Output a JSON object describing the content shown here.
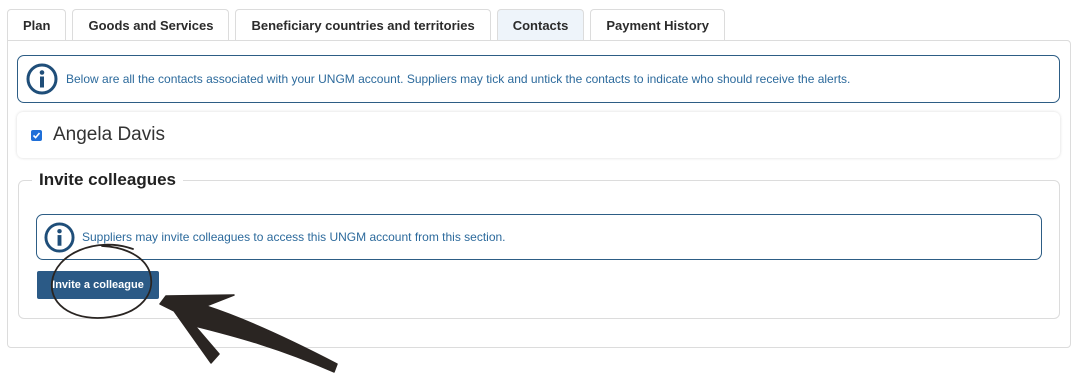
{
  "tabs": [
    {
      "label": "Plan",
      "active": false
    },
    {
      "label": "Goods and Services",
      "active": false
    },
    {
      "label": "Beneficiary countries and territories",
      "active": false
    },
    {
      "label": "Contacts",
      "active": true
    },
    {
      "label": "Payment History",
      "active": false
    }
  ],
  "info_banner": {
    "icon": "info-icon",
    "text": "Below are all the contacts associated with your UNGM account. Suppliers may tick and untick the contacts to indicate who should receive the alerts."
  },
  "contacts": [
    {
      "name": "Angela Davis",
      "checked": true
    }
  ],
  "invite_section": {
    "legend": "Invite colleagues",
    "info_icon": "info-icon",
    "info_text": "Suppliers may invite colleagues to access this UNGM account from this section.",
    "button_label": "Invite a colleague"
  },
  "colors": {
    "accent": "#2b5a86",
    "info_text": "#2c6a9c",
    "checkbox": "#1f6fd8",
    "annotation": "#2a2522"
  }
}
